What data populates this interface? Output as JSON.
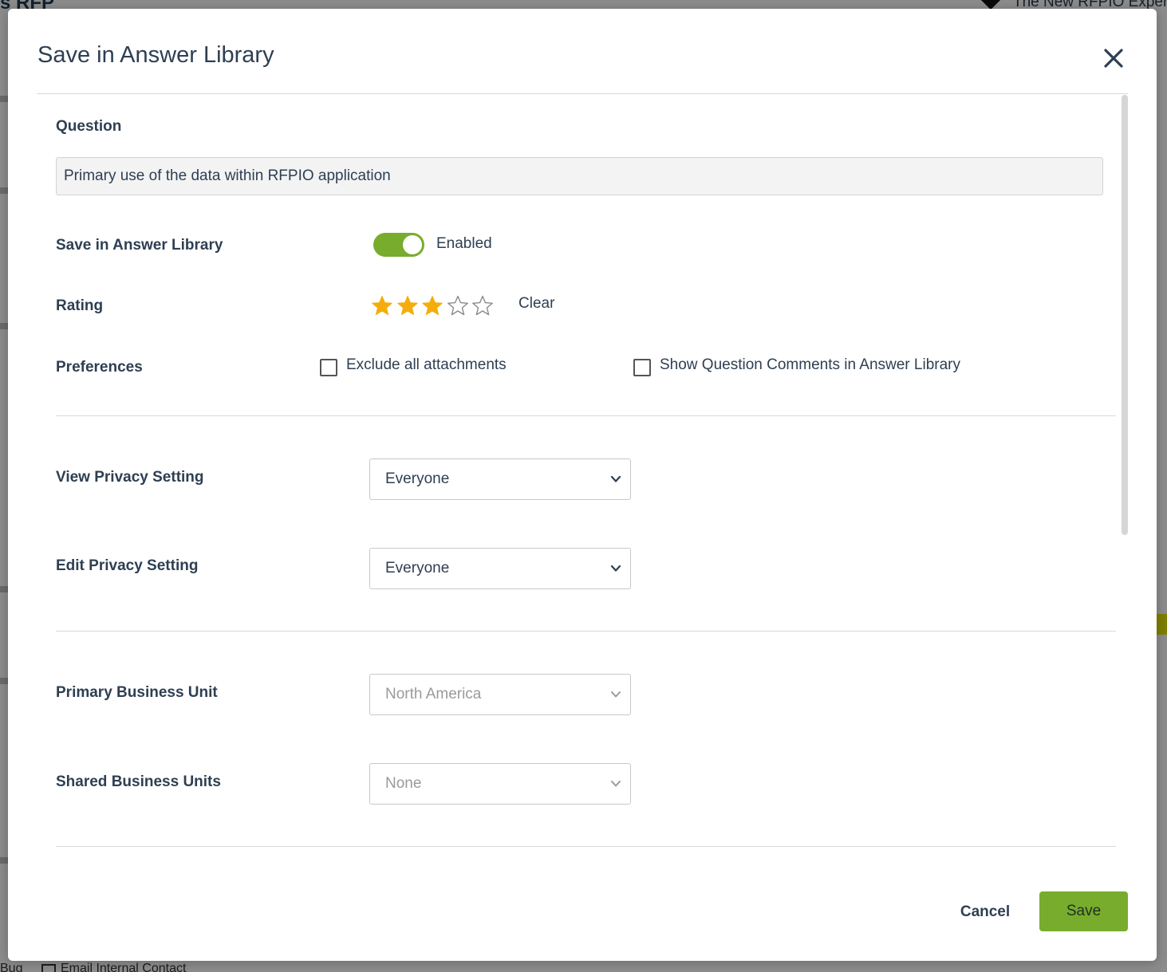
{
  "background": {
    "top_left_text": "s RFP",
    "top_right_text": "The New RFPIO Exper",
    "bottom_text": "Bug",
    "bottom_text_2": "Email Internal Contact"
  },
  "modal": {
    "title": "Save in Answer Library",
    "close_icon": "close-icon"
  },
  "question": {
    "label": "Question",
    "value": "Primary use of the data within RFPIO application"
  },
  "save_in_library": {
    "label": "Save in Answer Library",
    "enabled": true,
    "status_text": "Enabled"
  },
  "rating": {
    "label": "Rating",
    "value": 3,
    "max": 5,
    "clear_label": "Clear",
    "filled_color": "#f5ad0b",
    "empty_color": "#8a8a8a"
  },
  "preferences": {
    "label": "Preferences",
    "options": [
      {
        "label": "Exclude all attachments",
        "checked": false
      },
      {
        "label": "Show Question Comments in Answer Library",
        "checked": false
      }
    ]
  },
  "privacy": {
    "view_label": "View Privacy Setting",
    "view_value": "Everyone",
    "edit_label": "Edit Privacy Setting",
    "edit_value": "Everyone"
  },
  "business_units": {
    "primary_label": "Primary Business Unit",
    "primary_value": "North America",
    "shared_label": "Shared Business Units",
    "shared_value": "None"
  },
  "footer": {
    "cancel_label": "Cancel",
    "save_label": "Save",
    "accent_color": "#78ac2d"
  }
}
